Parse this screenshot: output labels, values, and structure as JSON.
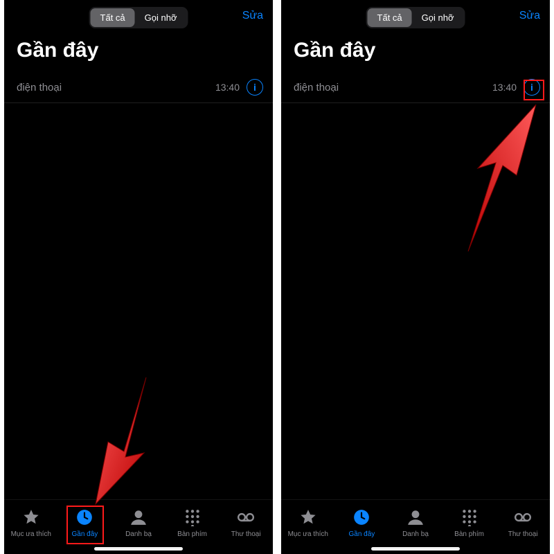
{
  "segmented": {
    "all": "Tất cả",
    "missed": "Gọi nhỡ"
  },
  "edit_label": "Sửa",
  "page_title": "Gần đây",
  "call": {
    "name": "điện thoại",
    "time": "13:40"
  },
  "tabs": {
    "favorites": "Mục ưa thích",
    "recents": "Gần đây",
    "contacts": "Danh bạ",
    "keypad": "Bàn phím",
    "voicemail": "Thư thoại"
  },
  "colors": {
    "accent": "#0a84ff",
    "annotation": "#ff1a1a"
  }
}
